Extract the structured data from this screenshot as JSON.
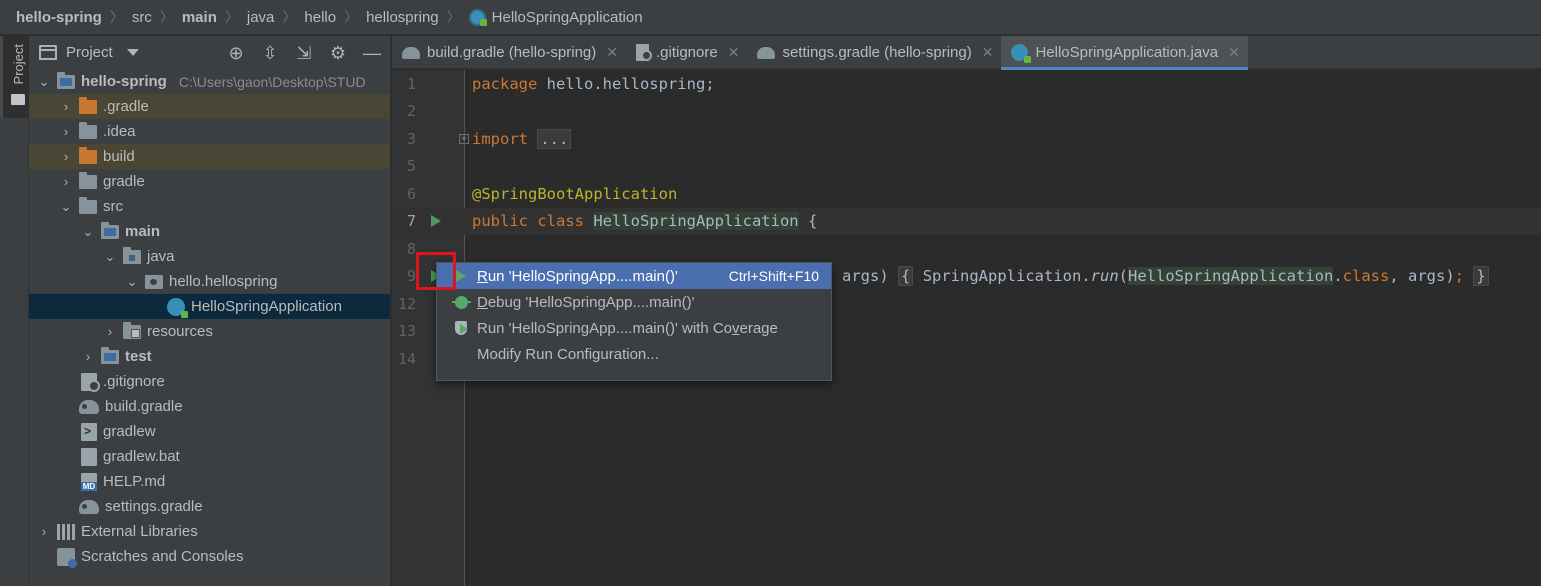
{
  "breadcrumb": [
    "hello-spring",
    "src",
    "main",
    "java",
    "hello",
    "hellospring",
    "HelloSpringApplication"
  ],
  "stripe": {
    "label": "Project"
  },
  "panel": {
    "title": "Project"
  },
  "tree": {
    "root": {
      "label": "hello-spring",
      "path": "C:\\Users\\gaon\\Desktop\\STUD"
    },
    "gradle_dot": ".gradle",
    "idea": ".idea",
    "build": "build",
    "gradle": "gradle",
    "src": "src",
    "main": "main",
    "java": "java",
    "package": "hello.hellospring",
    "app_class": "HelloSpringApplication",
    "resources": "resources",
    "test": "test",
    "gitignore": ".gitignore",
    "build_gradle": "build.gradle",
    "gradlew": "gradlew",
    "gradlew_bat": "gradlew.bat",
    "help": "HELP.md",
    "settings": "settings.gradle",
    "external": "External Libraries",
    "scratches": "Scratches and Consoles"
  },
  "tabs": [
    {
      "label": "build.gradle (hello-spring)",
      "icon": "gradle-icon"
    },
    {
      "label": ".gitignore",
      "icon": "gitignore-icon"
    },
    {
      "label": "settings.gradle (hello-spring)",
      "icon": "gradle-icon"
    },
    {
      "label": "HelloSpringApplication.java",
      "icon": "class-icon",
      "active": true
    }
  ],
  "editor": {
    "line_numbers": [
      "1",
      "2",
      "3",
      "5",
      "6",
      "7",
      "8",
      "9",
      "12",
      "13",
      "14"
    ],
    "l1_kw": "package",
    "l1_rest": " hello.hellospring;",
    "l3_kw": "import",
    "l3_fold": "...",
    "l6": "@SpringBootApplication",
    "l7_kw": "public class",
    "l7_cls": "HelloSpringApplication",
    "l7_rest": " {",
    "l9_args": "args)",
    "l9_open": "{",
    "l9_call": " SpringApplication.",
    "l9_run": "run",
    "l9_paren": "(",
    "l9_cls": "HelloSpringApplication",
    "l9_dot": ".",
    "l9_classkw": "class",
    "l9_comma": ", args)",
    "l9_semi": ";",
    "l9_close": "}"
  },
  "popup": {
    "run_label_u": "R",
    "run_label": "un 'HelloSpringApp....main()'",
    "run_shortcut": "Ctrl+Shift+F10",
    "debug_label_u": "D",
    "debug_label": "ebug 'HelloSpringApp....main()'",
    "cov_label_pre": "Run 'HelloSpringApp....main()' with Co",
    "cov_label_u": "v",
    "cov_label_post": "erage",
    "modify_label": "Modify Run Configuration..."
  }
}
